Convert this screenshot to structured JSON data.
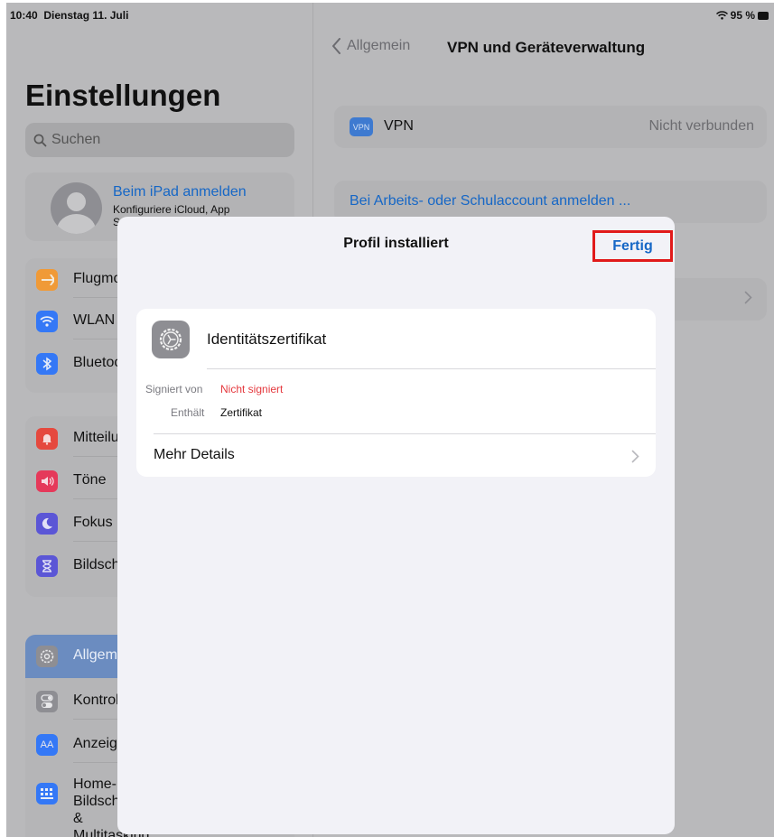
{
  "status_bar": {
    "time": "10:40",
    "date": "Dienstag 11. Juli",
    "battery": "95 %"
  },
  "sidebar": {
    "title": "Einstellungen",
    "search_placeholder": "Suchen",
    "account": {
      "title": "Beim iPad anmelden",
      "subtitle": "Konfiguriere iCloud, App",
      "subtitle2": "S"
    },
    "groups": [
      [
        {
          "label": "Flugmodus",
          "icon": "airplane-icon",
          "color": "#f09a37"
        },
        {
          "label": "WLAN",
          "icon": "wifi-icon",
          "color": "#3478f6"
        },
        {
          "label": "Bluetooth",
          "icon": "bluetooth-icon",
          "color": "#3478f6"
        }
      ],
      [
        {
          "label": "Mitteilungen",
          "icon": "bell-icon",
          "color": "#e5493e"
        },
        {
          "label": "Töne",
          "icon": "speaker-icon",
          "color": "#e5395a"
        },
        {
          "label": "Fokus",
          "icon": "moon-icon",
          "color": "#5b56d6"
        },
        {
          "label": "Bildschirmzeit",
          "icon": "hourglass-icon",
          "color": "#5b56d6"
        }
      ],
      [
        {
          "label": "Allgemein",
          "icon": "gear-icon",
          "color": "#8e8e93",
          "selected": true
        },
        {
          "label": "Kontrollzentrum",
          "icon": "toggles-icon",
          "color": "#8e8e93"
        },
        {
          "label": "Anzeige & Helligkeit",
          "icon": "textsize-icon",
          "color": "#3478f6"
        },
        {
          "label": "Home-Bildschirm & Multitasking",
          "icon": "grid-icon",
          "color": "#3478f6"
        }
      ]
    ]
  },
  "detail": {
    "back_label": "Allgemein",
    "title": "VPN und Geräteverwaltung",
    "vpn": {
      "badge": "VPN",
      "label": "VPN",
      "status": "Nicht verbunden"
    },
    "work_account": "Bei Arbeits- oder Schulaccount anmelden ..."
  },
  "modal": {
    "title": "Profil installiert",
    "done": "Fertig",
    "profile": {
      "name": "Identitätszertifikat",
      "signed_by_key": "Signiert von",
      "signed_by_value": "Nicht signiert",
      "contains_key": "Enthält",
      "contains_value": "Zertifikat",
      "more_details": "Mehr Details"
    }
  },
  "colors": {
    "accent": "#1667c6",
    "danger": "#e5393e",
    "highlight_box": "#e11a1a"
  }
}
